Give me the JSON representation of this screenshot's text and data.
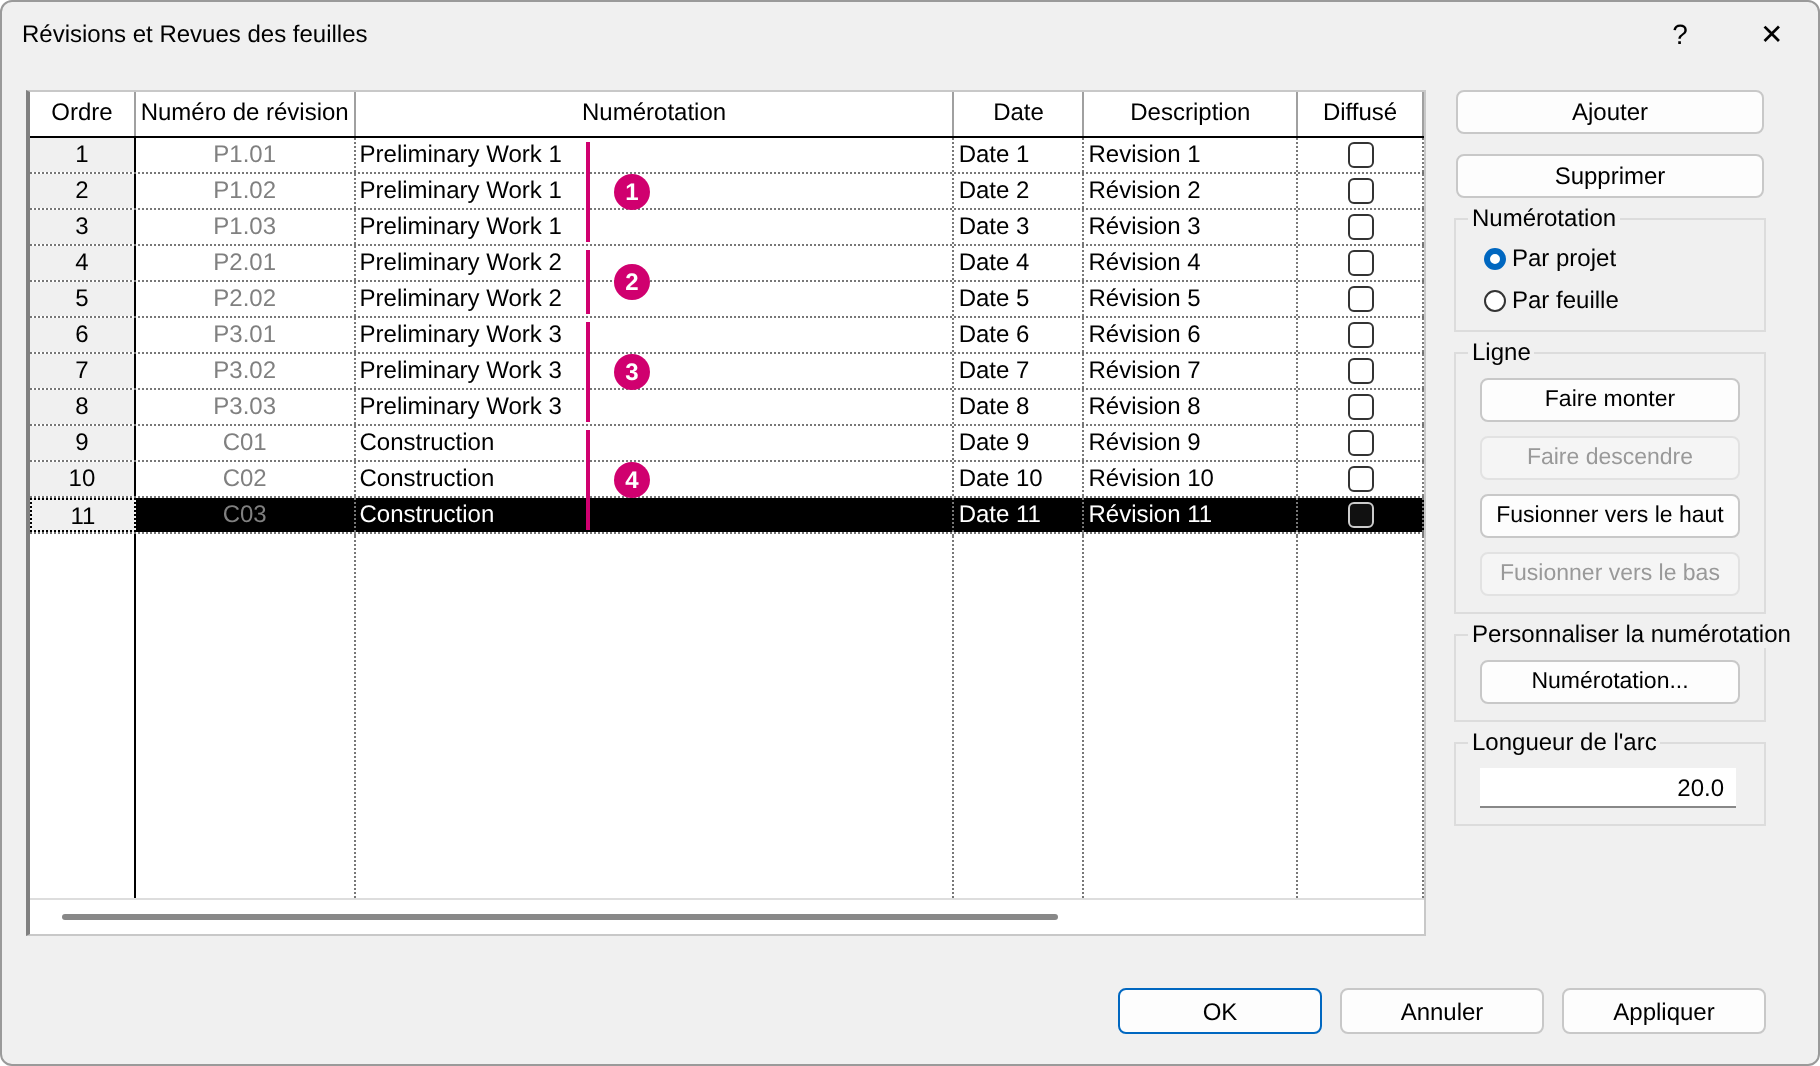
{
  "window": {
    "title": "Révisions et Revues des feuilles",
    "help": "?",
    "close": "✕"
  },
  "table": {
    "columns": [
      "Ordre",
      "Numéro de révision",
      "Numérotation",
      "Date",
      "Description",
      "Diffusé"
    ],
    "groups": [
      {
        "badge": "1",
        "rows": [
          {
            "order": "1",
            "number": "P1.01",
            "numbering": "Preliminary Work 1",
            "date": "Date 1",
            "description": "Revision 1",
            "issued": false,
            "selected": false
          },
          {
            "order": "2",
            "number": "P1.02",
            "numbering": "Preliminary Work 1",
            "date": "Date 2",
            "description": "Révision 2",
            "issued": false,
            "selected": false
          },
          {
            "order": "3",
            "number": "P1.03",
            "numbering": "Preliminary Work 1",
            "date": "Date 3",
            "description": "Révision 3",
            "issued": false,
            "selected": false
          }
        ]
      },
      {
        "badge": "2",
        "rows": [
          {
            "order": "4",
            "number": "P2.01",
            "numbering": "Preliminary Work 2",
            "date": "Date 4",
            "description": "Révision 4",
            "issued": false,
            "selected": false
          },
          {
            "order": "5",
            "number": "P2.02",
            "numbering": "Preliminary Work 2",
            "date": "Date 5",
            "description": "Révision 5",
            "issued": false,
            "selected": false
          }
        ]
      },
      {
        "badge": "3",
        "rows": [
          {
            "order": "6",
            "number": "P3.01",
            "numbering": "Preliminary Work 3",
            "date": "Date 6",
            "description": "Révision 6",
            "issued": false,
            "selected": false
          },
          {
            "order": "7",
            "number": "P3.02",
            "numbering": "Preliminary Work 3",
            "date": "Date 7",
            "description": "Révision 7",
            "issued": false,
            "selected": false
          },
          {
            "order": "8",
            "number": "P3.03",
            "numbering": "Preliminary Work 3",
            "date": "Date 8",
            "description": "Révision 8",
            "issued": false,
            "selected": false
          }
        ]
      },
      {
        "badge": "4",
        "rows": [
          {
            "order": "9",
            "number": "C01",
            "numbering": "Construction",
            "date": "Date 9",
            "description": "Révision 9",
            "issued": false,
            "selected": false
          },
          {
            "order": "10",
            "number": "C02",
            "numbering": "Construction",
            "date": "Date 10",
            "description": "Révision 10",
            "issued": false,
            "selected": false
          },
          {
            "order": "11",
            "number": "C03",
            "numbering": "Construction",
            "date": "Date 11",
            "description": "Révision 11",
            "issued": false,
            "selected": true
          }
        ]
      }
    ]
  },
  "actions": {
    "add": "Ajouter",
    "remove": "Supprimer"
  },
  "numbering": {
    "title": "Numérotation",
    "options": [
      {
        "label": "Par projet",
        "selected": true
      },
      {
        "label": "Par feuille",
        "selected": false
      }
    ]
  },
  "line": {
    "title": "Ligne",
    "buttons": [
      {
        "label": "Faire monter",
        "disabled": false
      },
      {
        "label": "Faire descendre",
        "disabled": true
      },
      {
        "label": "Fusionner vers le haut",
        "disabled": false
      },
      {
        "label": "Fusionner vers le bas",
        "disabled": true
      }
    ]
  },
  "custom": {
    "title": "Personnaliser la numérotation",
    "button": "Numérotation..."
  },
  "arc": {
    "title": "Longueur de l'arc",
    "value": "20.0"
  },
  "footer": [
    "OK",
    "Annuler",
    "Appliquer"
  ]
}
